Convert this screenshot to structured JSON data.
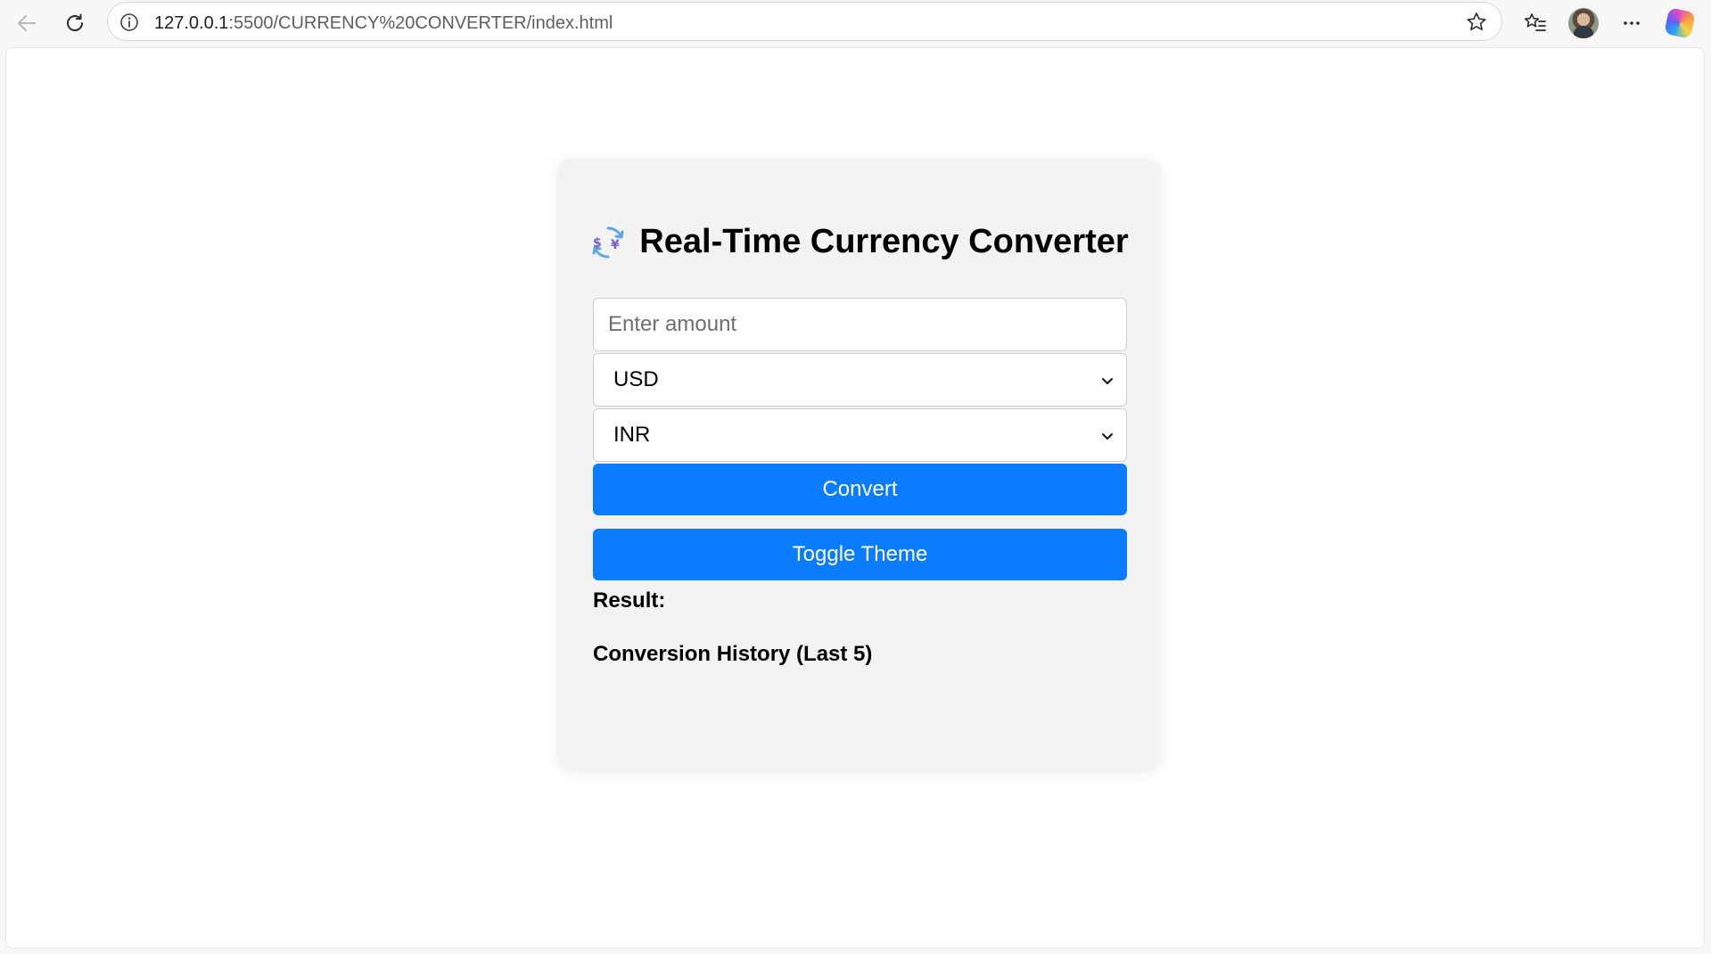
{
  "browser": {
    "url_host": "127.0.0.1",
    "url_rest": ":5500/CURRENCY%20CONVERTER/index.html",
    "icons": [
      "back-arrow-icon",
      "refresh-icon",
      "site-info-icon",
      "favorite-star-icon",
      "favorites-list-icon",
      "profile-avatar",
      "more-options-icon",
      "copilot-icon"
    ]
  },
  "app": {
    "title": "Real-Time Currency Converter",
    "title_icon": "currency-exchange-icon",
    "amount_placeholder": "Enter amount",
    "from_currency": "USD",
    "to_currency": "INR",
    "convert_label": "Convert",
    "toggle_theme_label": "Toggle Theme",
    "result_label": "Result:",
    "history_label": "Conversion History (Last 5)"
  },
  "colors": {
    "accent": "#0a7cff",
    "card_bg": "#f3f3f3",
    "page_bg": "#ffffff"
  }
}
